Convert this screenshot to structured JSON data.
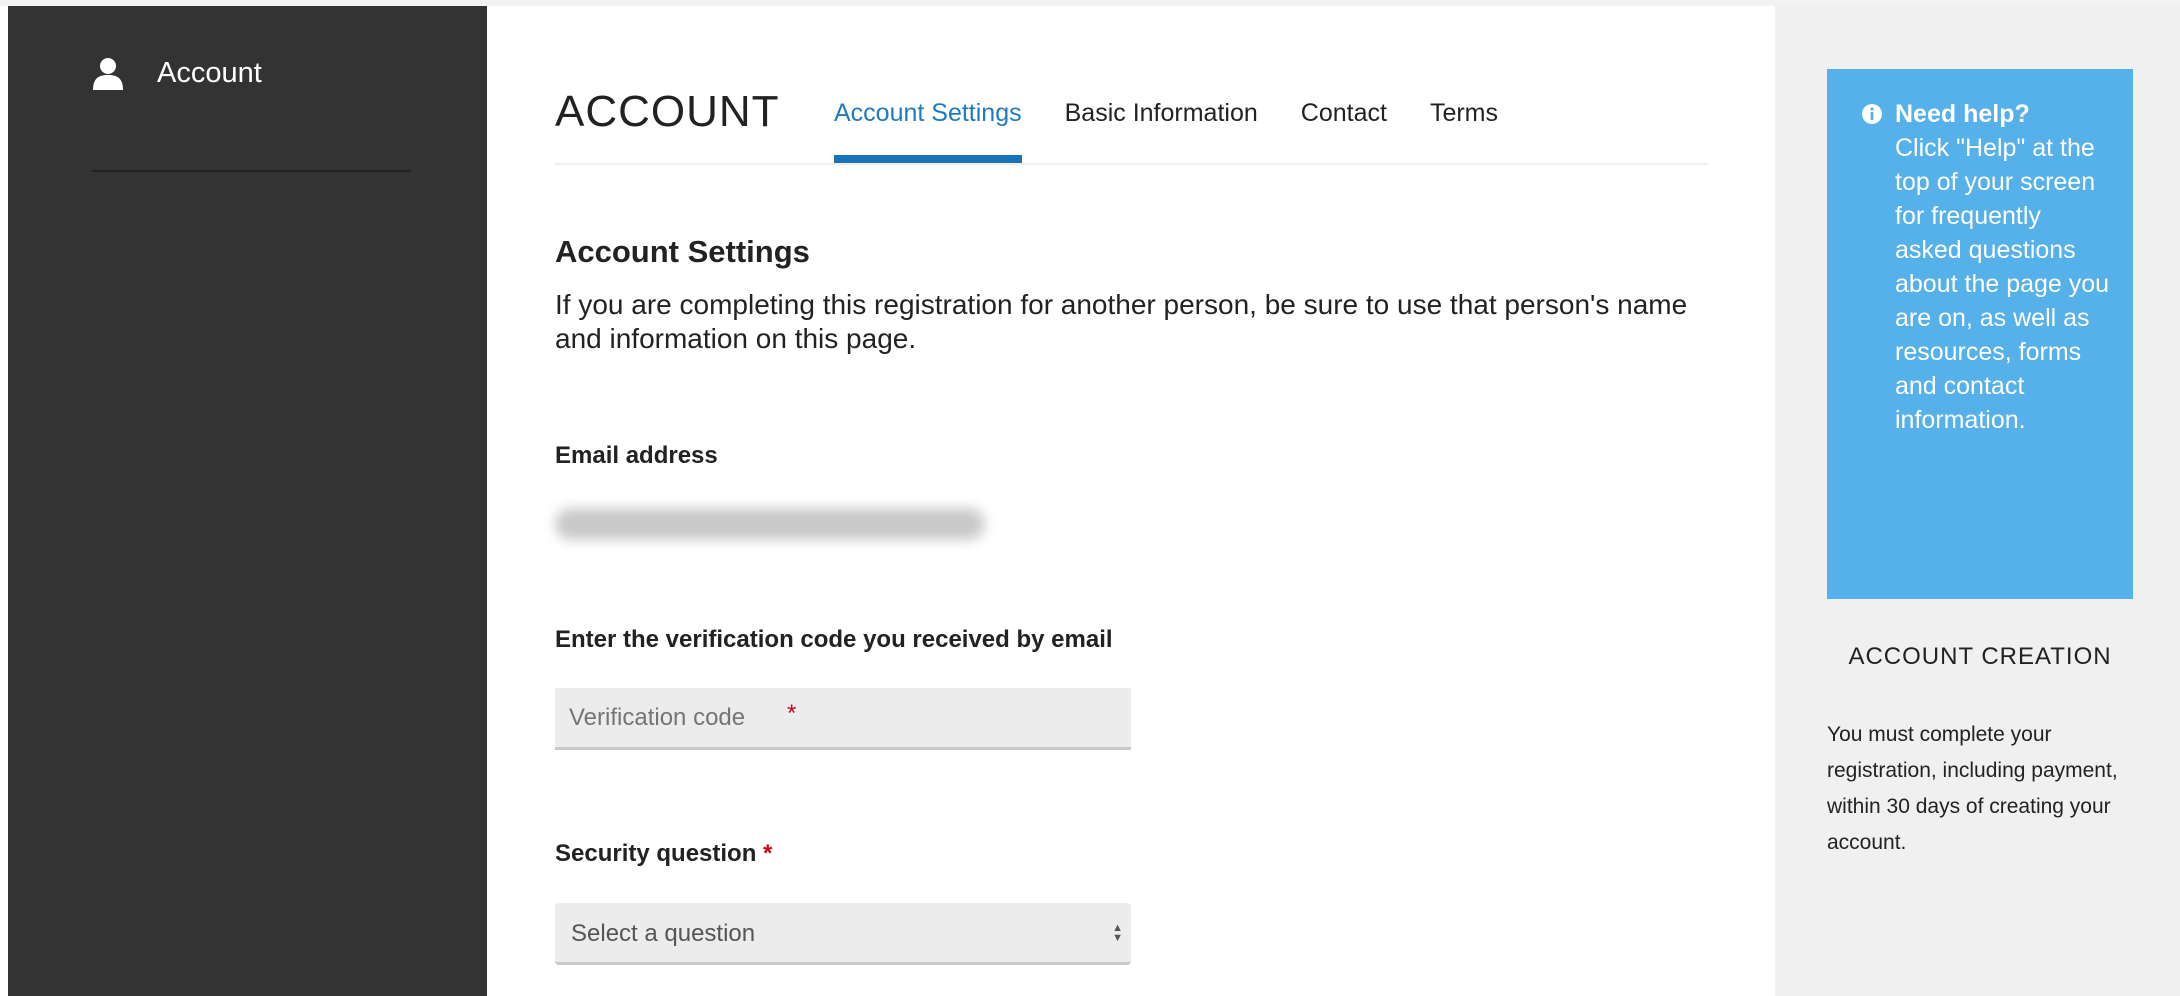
{
  "sidebar": {
    "items": [
      {
        "label": "Account",
        "icon": "user-icon"
      }
    ]
  },
  "header": {
    "title": "ACCOUNT",
    "tabs": [
      {
        "label": "Account Settings",
        "active": true
      },
      {
        "label": "Basic Information",
        "active": false
      },
      {
        "label": "Contact",
        "active": false
      },
      {
        "label": "Terms",
        "active": false
      }
    ]
  },
  "main": {
    "section_title": "Account Settings",
    "intro": "If you are completing this registration for another person, be sure to use that person's name and information on this page.",
    "email": {
      "label": "Email address"
    },
    "verification": {
      "label": "Enter the verification code you received by email",
      "placeholder": "Verification code",
      "required_mark": "*"
    },
    "security_question": {
      "label": "Security question",
      "required_mark": "*",
      "selected": "Select a question"
    }
  },
  "help": {
    "icon": "info-icon",
    "title": "Need help?",
    "body": "Click \"Help\" at the top of your screen for frequently asked questions about the page you are on, as well as resources, forms and contact information."
  },
  "account_creation": {
    "title": "ACCOUNT CREATION",
    "body": "You must complete your registration, including payment, within 30 days of creating your account."
  },
  "colors": {
    "sidebar_bg": "#333333",
    "accent": "#1a73b9",
    "help_bg": "#56b0ea",
    "required": "#d0021b"
  }
}
